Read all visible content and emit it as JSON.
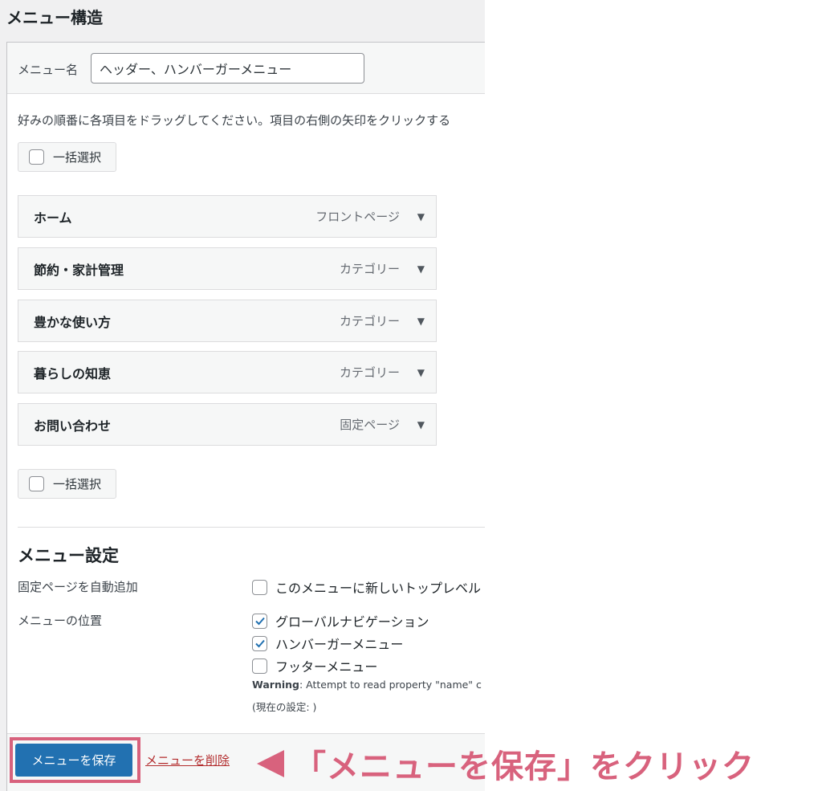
{
  "page": {
    "heading": "メニュー構造"
  },
  "menu_name": {
    "label": "メニュー名",
    "value": "ヘッダー、ハンバーガーメニュー"
  },
  "instructions": "好みの順番に各項目をドラッグしてください。項目の右側の矢印をクリックする",
  "bulk_select": {
    "label": "一括選択"
  },
  "menu_items": [
    {
      "title": "ホーム",
      "type": "フロントページ"
    },
    {
      "title": "節約・家計管理",
      "type": "カテゴリー"
    },
    {
      "title": "豊かな使い方",
      "type": "カテゴリー"
    },
    {
      "title": "暮らしの知恵",
      "type": "カテゴリー"
    },
    {
      "title": "お問い合わせ",
      "type": "固定ページ"
    }
  ],
  "settings": {
    "title": "メニュー設定",
    "auto_add_label": "固定ページを自動追加",
    "auto_add_option": "このメニューに新しいトップレベル",
    "location_label": "メニューの位置",
    "locations": [
      {
        "label": "グローバルナビゲーション",
        "checked": true
      },
      {
        "label": "ハンバーガーメニュー",
        "checked": true
      },
      {
        "label": "フッターメニュー",
        "checked": false
      }
    ],
    "warning_strong": "Warning",
    "warning_text": ": Attempt to read property \"name\" c",
    "current_setting": "(現在の設定: )"
  },
  "footer": {
    "save_label": "メニューを保存",
    "delete_label": "メニューを削除"
  },
  "annotation": {
    "text": "「メニューを保存」をクリック"
  },
  "colors": {
    "primary_button": "#2271b1",
    "annotation": "#d8627d",
    "delete_link": "#b32d2e",
    "checkmark": "#2271b1"
  }
}
